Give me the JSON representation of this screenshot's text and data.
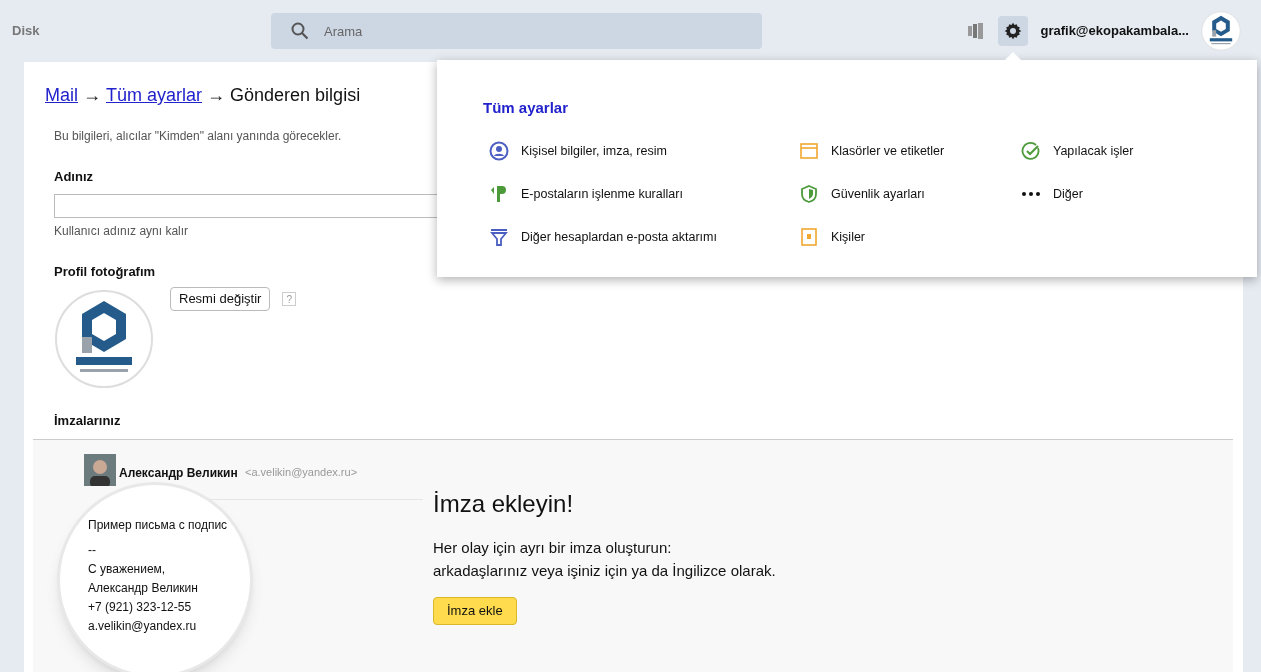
{
  "header": {
    "app_label": "Disk",
    "search": {
      "placeholder": "Arama"
    },
    "account": "grafik@ekopakambala..."
  },
  "breadcrumb": {
    "links": [
      "Mail",
      "Tüm ayarlar"
    ],
    "separator": "→",
    "current": "Gönderen bilgisi"
  },
  "intro": "Bu bilgileri, alıcılar \"Kimden\" alanı yanında görecekler.",
  "name_field": {
    "label": "Adınız",
    "hint": "Kullanıcı adınız aynı kalır"
  },
  "photo": {
    "label": "Profil fotoğrafım",
    "change_button": "Resmi değiştir",
    "help": "?"
  },
  "signatures": {
    "label": "İmzalarınız",
    "example": {
      "sender": "Александр Великин",
      "address": "<a.velikin@yandex.ru>",
      "lines": [
        "Пример письма с подпис",
        "--",
        "С уважением,",
        "Александр Великин",
        "+7 (921) 323-12-55",
        "a.velikin@yandex.ru"
      ]
    },
    "title": "İmza ekleyin!",
    "text_lines": [
      "Her olay için ayrı bir imza oluşturun:",
      "arkadaşlarınız veya işiniz için ya da İngilizce olarak."
    ],
    "add_button": "İmza ekle"
  },
  "settings_menu": {
    "title": "Tüm ayarlar",
    "columns": [
      [
        "Kişisel bilgiler, imza, resim",
        "E-postaların işlenme kuralları",
        "Diğer hesaplardan e-posta aktarımı"
      ],
      [
        "Klasörler ve etiketler",
        "Güvenlik ayarları",
        "Kişiler"
      ],
      [
        "Yapılacak işler",
        "Diğer"
      ]
    ]
  }
}
